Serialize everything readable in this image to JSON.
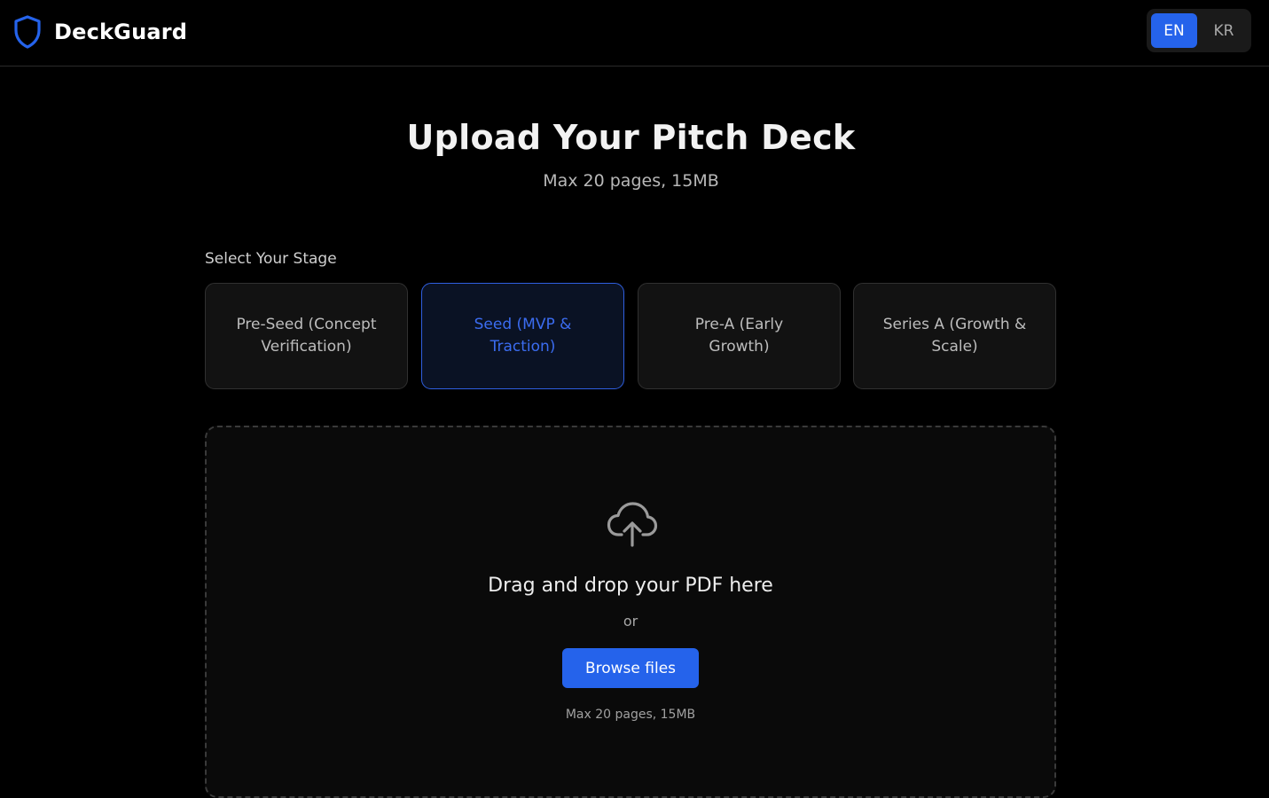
{
  "header": {
    "brand_name": "DeckGuard",
    "logo_icon": "shield-icon",
    "languages": [
      {
        "label": "EN",
        "active": true
      },
      {
        "label": "KR",
        "active": false
      }
    ]
  },
  "main": {
    "title": "Upload Your Pitch Deck",
    "subtitle": "Max 20 pages, 15MB",
    "stage_label": "Select Your Stage",
    "stages": [
      {
        "label": "Pre-Seed (Concept Verification)",
        "selected": false
      },
      {
        "label": "Seed (MVP & Traction)",
        "selected": true
      },
      {
        "label": "Pre-A (Early Growth)",
        "selected": false
      },
      {
        "label": "Series A (Growth & Scale)",
        "selected": false
      }
    ],
    "dropzone": {
      "icon": "cloud-upload-icon",
      "drop_text": "Drag and drop your PDF here",
      "or_text": "or",
      "browse_label": "Browse files",
      "limit_text": "Max 20 pages, 15MB"
    }
  },
  "colors": {
    "background": "#000000",
    "accent": "#2563eb",
    "selected_text": "#3b6cf0",
    "card_bg": "#121212",
    "selected_card_bg": "#0a1224"
  }
}
